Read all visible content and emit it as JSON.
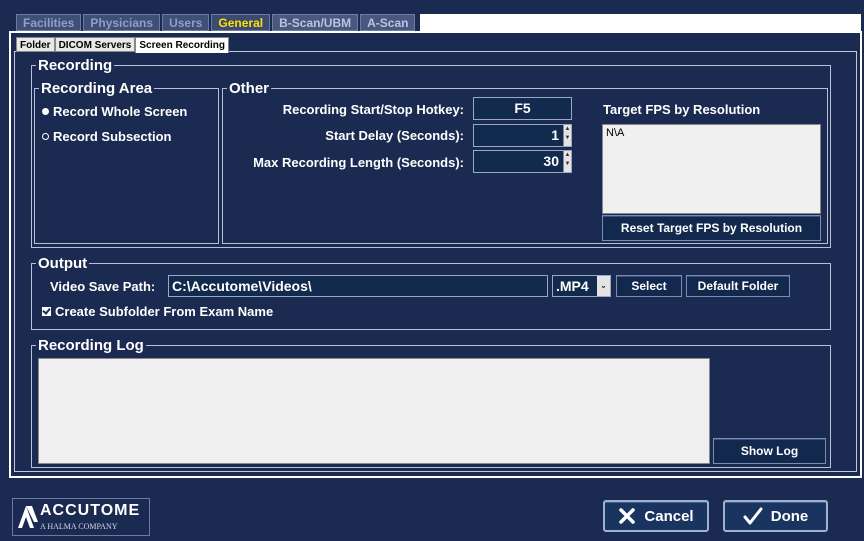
{
  "top_tabs": [
    {
      "label": "Facilities",
      "active": false
    },
    {
      "label": "Physicians",
      "active": false
    },
    {
      "label": "Users",
      "active": false
    },
    {
      "label": "General",
      "active": true
    },
    {
      "label": "B-Scan/UBM",
      "active": false
    },
    {
      "label": "A-Scan",
      "active": false
    }
  ],
  "sub_tabs": [
    {
      "label": "Folder"
    },
    {
      "label": "DICOM Servers"
    },
    {
      "label": "Screen Recording"
    }
  ],
  "recording": {
    "legend": "Recording",
    "area": {
      "legend": "Recording Area",
      "options": [
        {
          "label": "Record Whole Screen",
          "selected": true
        },
        {
          "label": "Record Subsection",
          "selected": false
        }
      ]
    },
    "other": {
      "legend": "Other",
      "hotkey_label": "Recording Start/Stop Hotkey:",
      "hotkey_value": "F5",
      "start_delay_label": "Start Delay (Seconds):",
      "start_delay_value": "1",
      "max_length_label": "Max Recording Length (Seconds):",
      "max_length_value": "30",
      "fps_title": "Target FPS by Resolution",
      "fps_list_value": "N\\A",
      "fps_reset_button": "Reset Target FPS by Resolution"
    }
  },
  "output": {
    "legend": "Output",
    "path_label": "Video Save Path:",
    "path_value": "C:\\Accutome\\Videos\\",
    "format_value": ".MP4",
    "select_button": "Select",
    "default_folder_button": "Default Folder",
    "subfolder_checkbox_label": "Create Subfolder From Exam Name",
    "subfolder_checked": true
  },
  "log": {
    "legend": "Recording Log",
    "show_log_button": "Show Log"
  },
  "footer": {
    "logo_text": "ACCUTOME",
    "logo_subtext": "A HALMA COMPANY",
    "cancel_button": "Cancel",
    "done_button": "Done"
  },
  "colors": {
    "background": "#1a2a50",
    "active_tab_text": "#ffe000",
    "field_bg": "#132a4f"
  }
}
